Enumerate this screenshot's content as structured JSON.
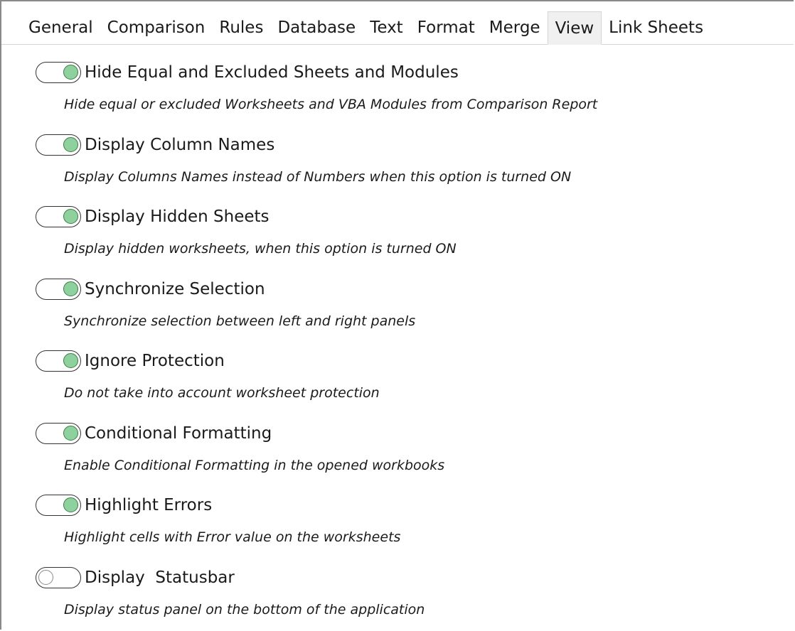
{
  "tabs": [
    {
      "label": "General",
      "active": false
    },
    {
      "label": "Comparison",
      "active": false
    },
    {
      "label": "Rules",
      "active": false
    },
    {
      "label": "Database",
      "active": false
    },
    {
      "label": "Text",
      "active": false
    },
    {
      "label": "Format",
      "active": false
    },
    {
      "label": "Merge",
      "active": false
    },
    {
      "label": "View",
      "active": true
    },
    {
      "label": "Link Sheets",
      "active": false
    }
  ],
  "options": [
    {
      "label": "Hide Equal and Excluded Sheets and Modules",
      "description": "Hide equal or excluded Worksheets and VBA Modules from Comparison Report",
      "enabled": true
    },
    {
      "label": "Display Column Names",
      "description": "Display Columns Names instead of Numbers when this option is turned ON",
      "enabled": true
    },
    {
      "label": "Display Hidden Sheets",
      "description": "Display hidden worksheets, when this option is turned ON",
      "enabled": true
    },
    {
      "label": "Synchronize Selection",
      "description": "Synchronize selection between left and right panels",
      "enabled": true
    },
    {
      "label": "Ignore Protection",
      "description": "Do not take into account worksheet protection",
      "enabled": true
    },
    {
      "label": "Conditional Formatting",
      "description": "Enable Conditional Formatting in the opened workbooks",
      "enabled": true
    },
    {
      "label": "Highlight Errors",
      "description": "Highlight cells with Error value on the worksheets",
      "enabled": true
    },
    {
      "label": "Display  Statusbar",
      "description": "Display status panel on the bottom of the application",
      "enabled": false
    }
  ],
  "colors": {
    "toggle_on_knob": "#8fd19e",
    "toggle_on_border": "#3a7d46",
    "active_tab_bg": "#f0f0f0"
  }
}
